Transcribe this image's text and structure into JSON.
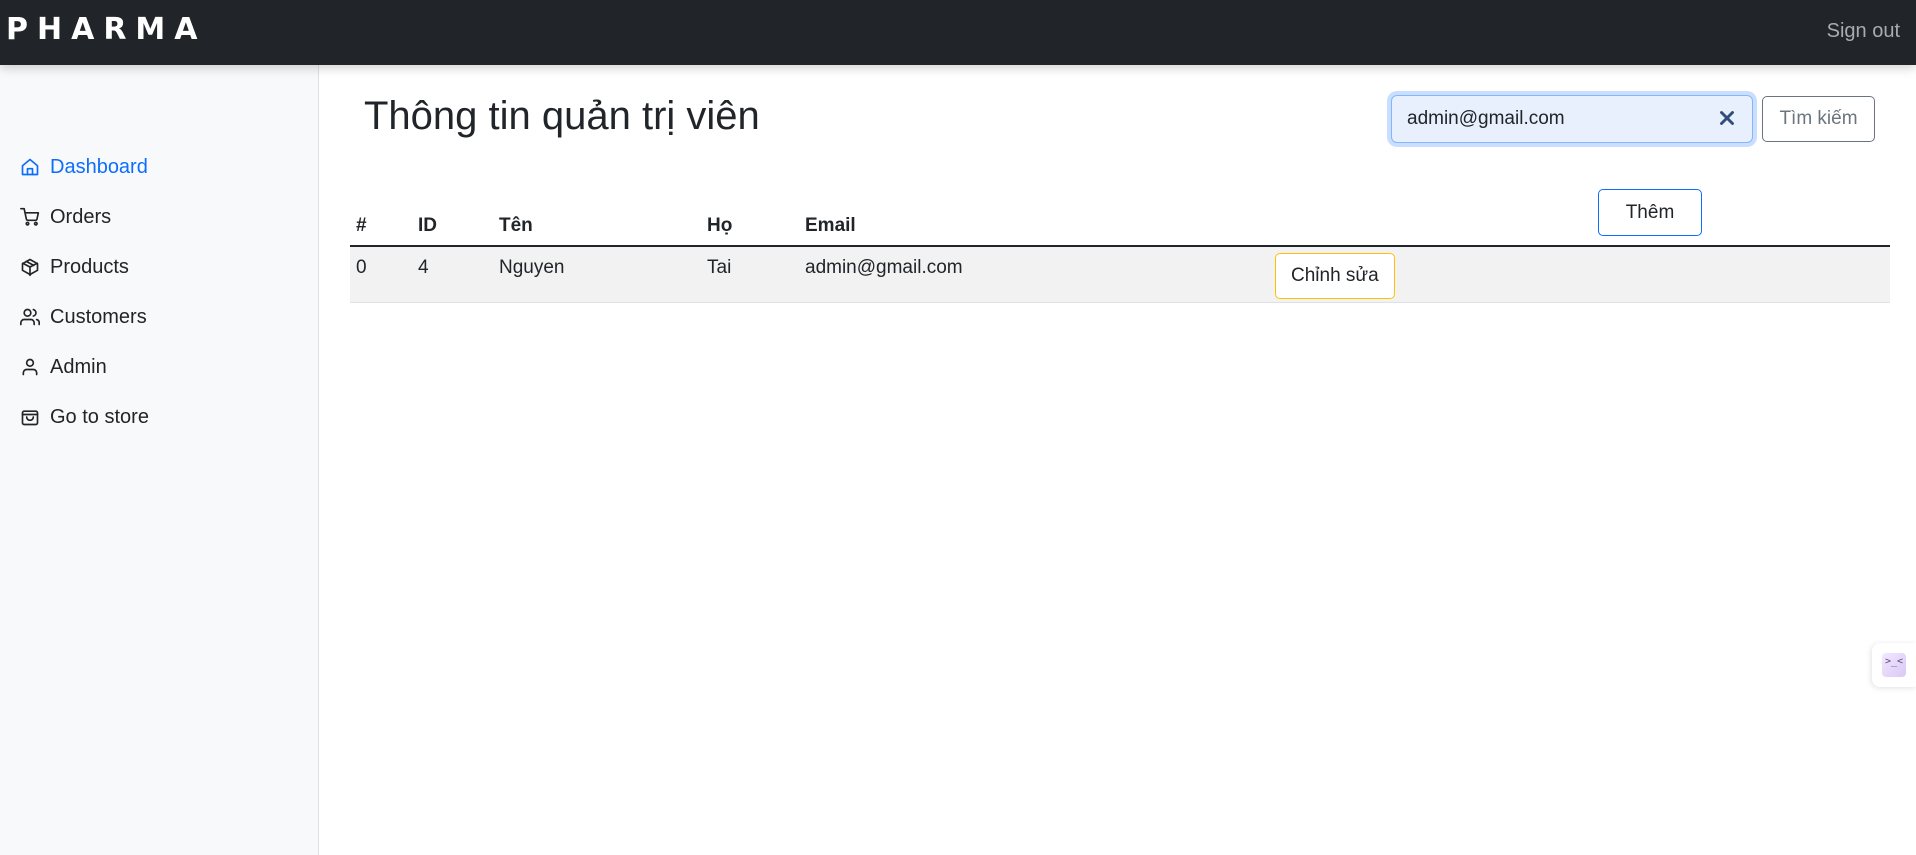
{
  "header": {
    "brand": "PHARMA",
    "sign_out": "Sign out"
  },
  "sidebar": {
    "items": [
      {
        "label": "Dashboard",
        "icon": "home-icon",
        "active": true
      },
      {
        "label": "Orders",
        "icon": "cart-icon"
      },
      {
        "label": "Products",
        "icon": "box-icon"
      },
      {
        "label": "Customers",
        "icon": "users-icon"
      },
      {
        "label": "Admin",
        "icon": "user-icon"
      },
      {
        "label": "Go to store",
        "icon": "shopping-bag-icon"
      }
    ]
  },
  "main": {
    "title": "Thông tin quản trị viên",
    "search": {
      "value": "admin@gmail.com",
      "button": "Tìm kiếm"
    },
    "add_button": "Thêm",
    "table": {
      "headers": [
        "#",
        "ID",
        "Tên",
        "Họ",
        "Email"
      ],
      "rows": [
        {
          "index": "0",
          "id": "4",
          "first_name": "Nguyen",
          "last_name": "Tai",
          "email": "admin@gmail.com",
          "action": "Chỉnh sửa"
        }
      ]
    }
  },
  "extension": {
    "glyph": ">_<"
  },
  "colors": {
    "topbar": "#212529",
    "active_link": "#0d6efd",
    "add_button_border": "#0d6efd",
    "edit_button_border": "#ffc107"
  }
}
